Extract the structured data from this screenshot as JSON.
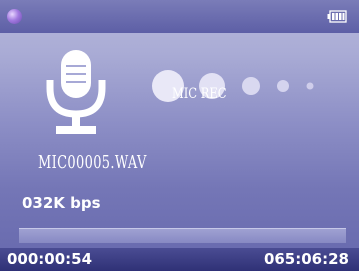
{
  "status_bar": {
    "status_icon": "status-dot-icon",
    "battery_icon": "battery-icon"
  },
  "recorder": {
    "mode_label": "MIC REC",
    "file_name": "MIC00005.WAV",
    "bitrate": "032K bps",
    "mic_icon": "microphone-icon",
    "progress_fraction": 0.0
  },
  "time": {
    "elapsed": "000:00:54",
    "total": "065:06:28"
  },
  "colors": {
    "background_top": "#b7b9dc",
    "background_bottom": "#6668ad",
    "bar": "#5d5fa6",
    "text": "#ffffff"
  }
}
